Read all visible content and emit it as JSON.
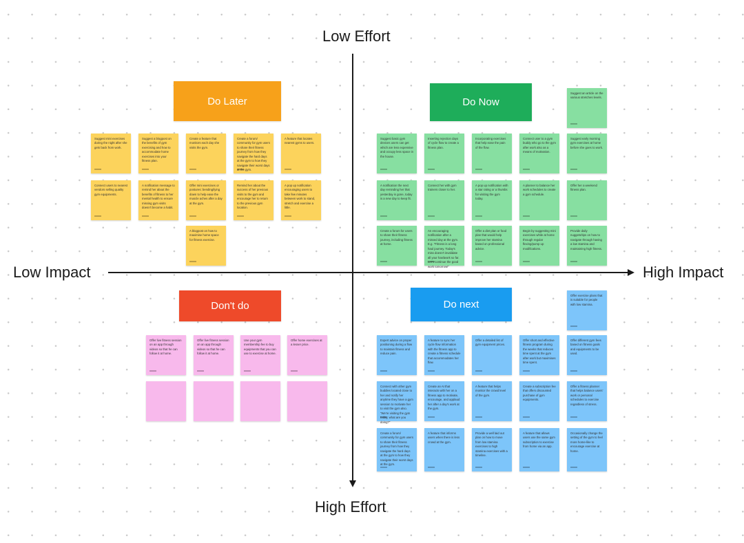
{
  "axes": {
    "top": "Low Effort",
    "bottom": "High Effort",
    "left": "Low Impact",
    "right": "High Impact"
  },
  "colors": {
    "do_later": "#f7a11a",
    "do_now": "#1ead5a",
    "dont_do": "#ee4a2a",
    "do_next": "#199cf0",
    "yellow_note": "#fcd35c",
    "green_note": "#87dfa1",
    "pink_note": "#f8b9ec",
    "blue_note": "#7dc5fa"
  },
  "quadrants": {
    "do_later": {
      "title": "Do Later",
      "notes": [
        "Suggest mini exercises during the night after she gets back from work.",
        "Suggest a blogpost on the benefits of gym exercising and how to accommodate home exercises into your fitness plan.",
        "Create a feature that monitors each day she visits the gym.",
        "Create a forum/ community for gym users to share their fitness journey from how they navigate the hard days at the gym to how they navigate their worst days at the gym.",
        "A feature that locates nearest gyms to users.",
        "Connect users to nearest vendors selling quality gym equipments.",
        "A notification message to remind her about the benefits of fitness to her mental health to ensure missing gym visits doesn't become a habit.",
        "Offer mini exercises or postures: bending/lying down to help ease the muscle aches after a day at the gym.",
        "Remind her about the success of her previous visits to the gym and encourage her to return to the previous gym location.",
        "A pop up notification encouraging users to take few minutes between work to stand, stretch and exercise a little.",
        "A blogpost on how to maximise home space for fitness exercise."
      ]
    },
    "do_now": {
      "title": "Do Now",
      "notes": [
        "Suggest an article on the various stretches levels.",
        "Suggest basic gym devices users can get which are less expensive and occupy less space in the house.",
        "Inserting rejection days of cycle flow to create a fitness plan.",
        "Incorporating exercises that help ease the pain of the flow.",
        "Connect user to a gym buddy who go to the gym after work also as a means of motivation.",
        "Suggest early morning gym exercises at home before she goes to work.",
        "A notification the next day reminding her that yesterday is gone, today is a new day to keep fit.",
        "Connect her with gym trainers closer to her.",
        "A pop up notification with a star rating or a thumbs for visiting the gym today.",
        "A planner to balance her work schedules to create a gym schedule.",
        "Offer her a weekend fitness plan.",
        "Create a forum for users to share their fitness journey, including fitness at home.",
        "An encouraging notification after a missed day at the gym. E.g. \"Fitness is a long haul journey. Today's miss doesn't invalidate all your hardwork so far. Let's continue the good work tomorrow!\"",
        "Offer a diet plan or food plan that would help improve her stamina based on professional advice.",
        "Begin by suggesting mini exercises while at home through regular flexing/pump up modifications.",
        "Provide daily nuggets/tips on how to navigate through having a low stamina and maintaining high fitness."
      ]
    },
    "dont_do": {
      "title": "Don't do",
      "notes": [
        "Offer live fitness session on an app through videos so that he can follow it at home.",
        "Offer live fitness session on an app through videos so that he can follow it at home.",
        "Use your gym membership fee to buy equipments that you can use to exercise at home.",
        "Offer home exercises at a lesser price.",
        "",
        "",
        "",
        ""
      ]
    },
    "do_next": {
      "title": "Do next",
      "notes": [
        "Offer exercise plans that is suitable for people with low stamina.",
        "Expert advice on proper positioning during a flow to maintain fitness and reduce pain.",
        "A feature to sync her cycle flow information with the fitness app to create a fitness schedule that accommodates her flow.",
        "Offer a detailed list of gym equipment prices.",
        "Offer short and effective fitness program during the weeks that reduces time spent at the gym after work but maximises time spent.",
        "Offer different gym fees based on fitness goals and equipments to be used.",
        "Connect with other gym buddies located close to her and notify her anytime they have a gym session to motivate her to visit the gym also. \"We're visiting the gym today, what are you doing?\"",
        "Create an AI that interacts with her on a fitness app to motivate, encourage, and applaud her after a day's work at the gym.",
        "A feature that helps monitor the crowd level of the gym.",
        "Create a subscription fee that offers discounted purchase of gym equipments.",
        "Offer a fitness planner that helps balance users' work or personal schedules to exercise regardless of stress.",
        "Create a forum/ community for gym users to share their fitness journey from how they navigate the hard days at the gym to how they navigate their worst days at the gym.",
        "A feature that informs users when there is less crowd at the gym.",
        "Provide a well laid out plan on how to move from low stamina exercises to high stamina exercises with a timeline.",
        "A feature that allows users use the same gym subscription to exercise from home via an app.",
        "Occasionally change the setting of the gym to feel more home-like to encourage exercise at home."
      ]
    }
  }
}
